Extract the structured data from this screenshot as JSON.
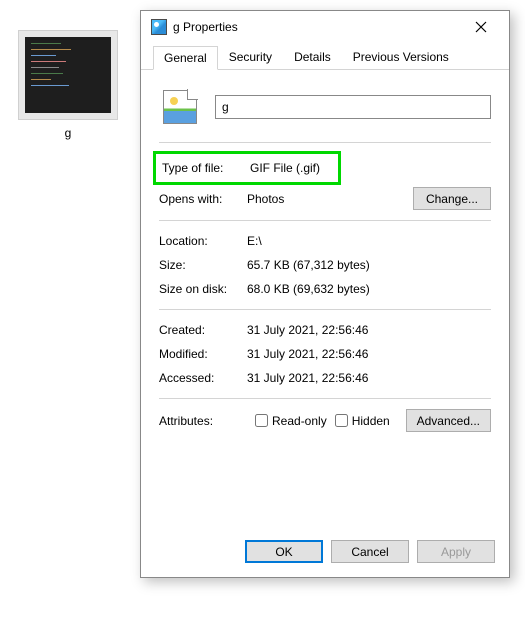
{
  "desktop": {
    "file_label": "g"
  },
  "dialog": {
    "title": "g Properties",
    "tabs": {
      "general": "General",
      "security": "Security",
      "details": "Details",
      "previous": "Previous Versions"
    },
    "filename": "g",
    "labels": {
      "type_of_file": "Type of file:",
      "opens_with": "Opens with:",
      "location": "Location:",
      "size": "Size:",
      "size_on_disk": "Size on disk:",
      "created": "Created:",
      "modified": "Modified:",
      "accessed": "Accessed:",
      "attributes": "Attributes:",
      "read_only": "Read-only",
      "hidden": "Hidden"
    },
    "values": {
      "type_of_file": "GIF File (.gif)",
      "opens_with": "Photos",
      "location": "E:\\",
      "size": "65.7 KB (67,312 bytes)",
      "size_on_disk": "68.0 KB (69,632 bytes)",
      "created": "31 July 2021, 22:56:46",
      "modified": "31 July 2021, 22:56:46",
      "accessed": "31 July 2021, 22:56:46"
    },
    "buttons": {
      "change": "Change...",
      "advanced": "Advanced...",
      "ok": "OK",
      "cancel": "Cancel",
      "apply": "Apply"
    }
  }
}
